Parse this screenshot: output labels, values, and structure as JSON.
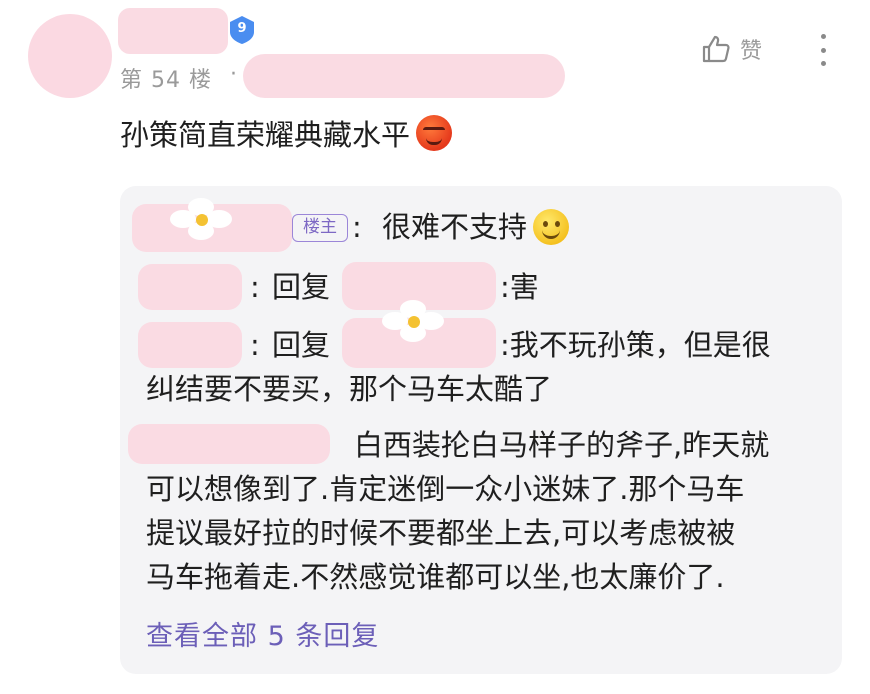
{
  "post": {
    "level_badge": "9",
    "floor_label": "第 54 楼",
    "floor_separator": "·",
    "like_label": "赞",
    "comment_text": "孙策简直荣耀典藏水平",
    "comment_emoji": "smirk-emoji"
  },
  "replies": {
    "owner_tag": "楼主",
    "items": [
      {
        "sep": ":",
        "text": "很难不支持",
        "emoji": "smile-emoji"
      },
      {
        "sep": ":",
        "reply_word": "回复",
        "text": ":害"
      },
      {
        "sep": ":",
        "reply_word": "回复",
        "text": ":我不玩孙策，但是很",
        "text_line2": "纠结要不要买，那个马车太酷了"
      },
      {
        "line1": "白西装抡白马样子的斧子,昨天就",
        "line2": "可以想像到了.肯定迷倒一众小迷妹了.那个马车",
        "line3": "提议最好拉的时候不要都坐上去,可以考虑被被",
        "line4": "马车拖着走.不然感觉谁都可以坐,也太廉价了."
      }
    ],
    "view_all": "查看全部 5 条回复"
  },
  "colors": {
    "accent_purple": "#6c5fb8",
    "badge_blue": "#4a8df0",
    "blur_pink": "#fadbe3",
    "reply_bg": "#f4f4f6"
  }
}
